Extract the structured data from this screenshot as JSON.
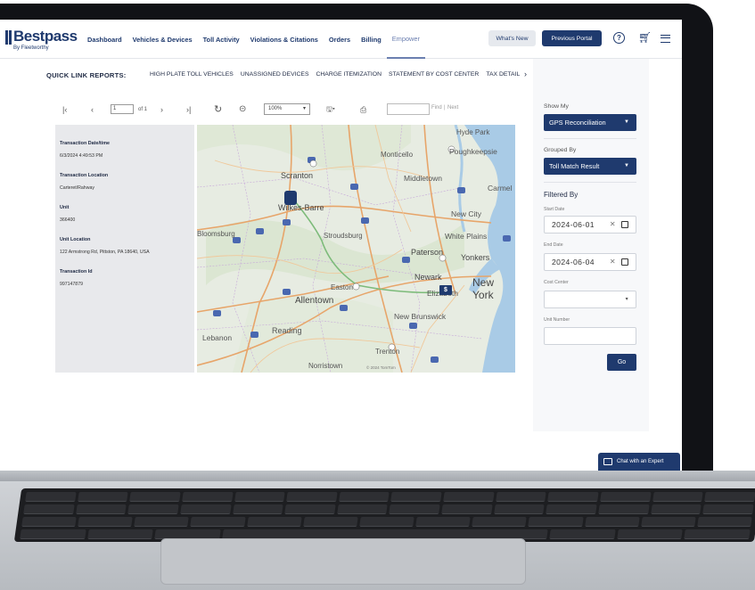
{
  "brand": {
    "name": "Bestpass",
    "tagline": "By Fleetworthy",
    "trademark": "®"
  },
  "nav": {
    "items": [
      "Dashboard",
      "Vehicles & Devices",
      "Toll Activity",
      "Violations & Citations",
      "Orders",
      "Billing",
      "Empower"
    ],
    "active": "Empower",
    "whats_new": "What's New",
    "previous_portal": "Previous Portal",
    "help_symbol": "?"
  },
  "quick_links": {
    "title": "QUICK LINK REPORTS:",
    "links": [
      "HIGH PLATE TOLL VEHICLES",
      "UNASSIGNED DEVICES",
      "CHARGE ITEMIZATION",
      "STATEMENT BY COST CENTER",
      "TAX DETAIL"
    ]
  },
  "report_toolbar": {
    "page_value": "1",
    "page_of": "of 1",
    "zoom": "100%",
    "find_label": "Find",
    "next_label": "Next"
  },
  "transaction": {
    "date_label": "Transaction Date/time",
    "date_value": "6/3/2024 4:49:53 PM",
    "location_label": "Transaction Location",
    "location_value": "Carteret/Rahway",
    "unit_label": "Unit",
    "unit_value": "366400",
    "unit_location_label": "Unit Location",
    "unit_location_value": "122 Armstrong Rd, Pittston, PA 18640, USA",
    "id_label": "Transaction Id",
    "id_value": "997147879"
  },
  "map": {
    "labels": [
      "Hyde Park",
      "Monticello",
      "Poughkeepsie",
      "Scranton",
      "Middletown",
      "Wilkes-Barre",
      "Carmel",
      "New City",
      "Bloomsburg",
      "Stroudsburg",
      "White Plains",
      "Paterson",
      "Yonkers",
      "Newark",
      "Elizabeth",
      "New York",
      "Allentown",
      "Easton",
      "New Brunswick",
      "Reading",
      "Lebanon",
      "Trenton",
      "Norristown"
    ],
    "attribution": "© 2024 TomTom",
    "marker_symbol": "$"
  },
  "filters": {
    "show_my_label": "Show My",
    "show_my_value": "GPS Reconciliation",
    "grouped_by_label": "Grouped By",
    "grouped_by_value": "Toll Match Result",
    "filtered_by": "Filtered By",
    "start_date_label": "Start Date",
    "start_date_value": "2024-06-01",
    "end_date_label": "End Date",
    "end_date_value": "2024-06-04",
    "cost_center_label": "Cost Center",
    "unit_number_label": "Unit Number",
    "go_label": "Go"
  },
  "chat": {
    "label": "Chat with an Expert"
  },
  "colors": {
    "brand_navy": "#1f3a6e",
    "panel_bg": "#f7f8fa",
    "details_bg": "#e8e9ec"
  }
}
